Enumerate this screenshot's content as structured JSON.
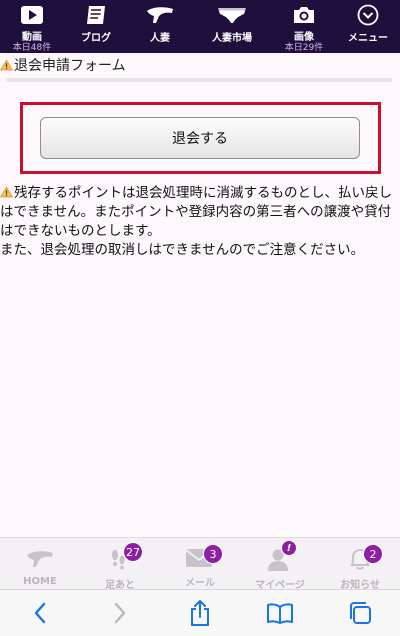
{
  "top_nav": {
    "items": [
      {
        "label": "動画",
        "count": "本日48件",
        "icon": "play-icon"
      },
      {
        "label": "ブログ",
        "count": "",
        "icon": "book-icon"
      },
      {
        "label": "人妻",
        "count": "",
        "icon": "heel-icon"
      },
      {
        "label": "人妻市場",
        "count": "",
        "icon": "underwear-icon"
      },
      {
        "label": "画像",
        "count": "本日29件",
        "icon": "camera-icon"
      },
      {
        "label": "メニュー",
        "count": "",
        "icon": "chevron-down-icon"
      }
    ]
  },
  "form": {
    "title": "退会申請フォーム",
    "button_label": "退会する",
    "notice": "残存するポイントは退会処理時に消滅するものとし、払い戻しはできません。またポイントや登録内容の第三者への譲渡や貸付はできないものとします。\nまた、退会処理の取消しはできませんのでご注意ください。",
    "highlight_color": "#c8102e"
  },
  "app_tabs": {
    "items": [
      {
        "label": "HOME",
        "icon": "heel-icon",
        "badge": ""
      },
      {
        "label": "足あと",
        "icon": "footprint-icon",
        "badge": "27"
      },
      {
        "label": "メール",
        "icon": "mail-icon",
        "badge": "3"
      },
      {
        "label": "マイページ",
        "icon": "user-icon",
        "badge": "!"
      },
      {
        "label": "お知らせ",
        "icon": "bell-icon",
        "badge": "2"
      }
    ],
    "badge_color": "#8e1fa3"
  },
  "browser": {
    "buttons": [
      "back-icon",
      "forward-icon",
      "share-icon",
      "bookmarks-icon",
      "tabs-icon"
    ]
  }
}
